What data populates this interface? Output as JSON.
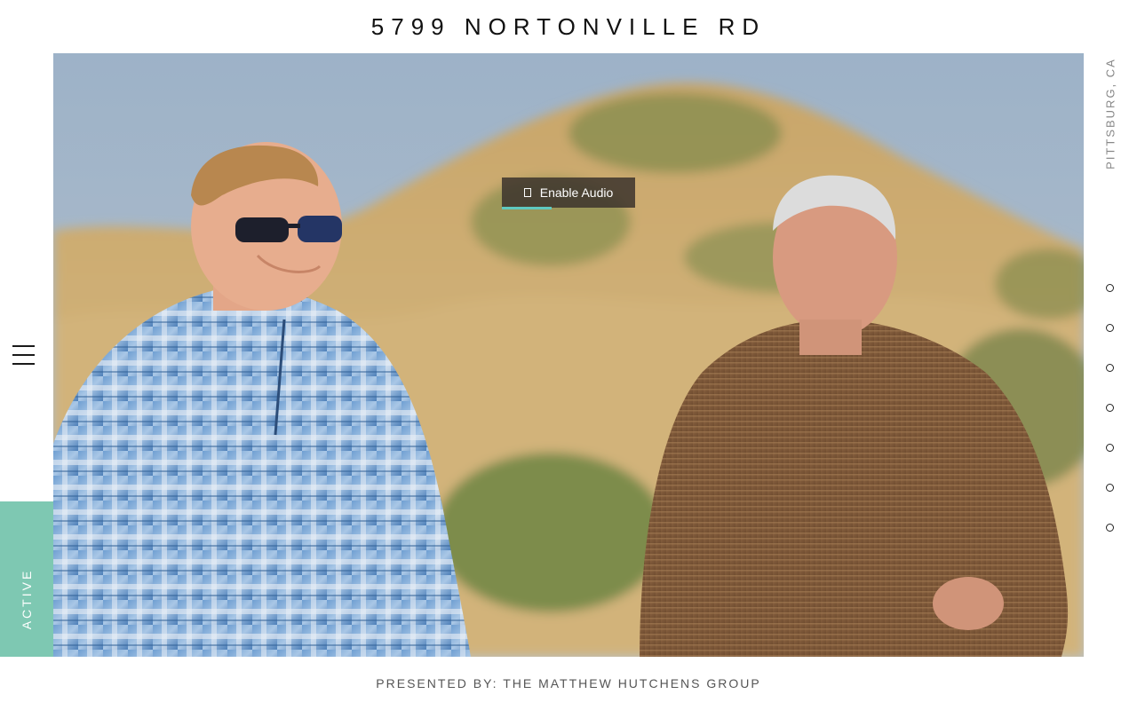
{
  "header": {
    "title": "5799 NORTONVILLE RD"
  },
  "sidebar_left": {
    "menu_icon": "hamburger-menu-icon",
    "status_label": "ACTIVE",
    "status_color": "#7ec8b2"
  },
  "hero": {
    "audio_button": {
      "icon": "speaker-icon",
      "label": "Enable Audio",
      "progress": 0.37,
      "progress_color": "#5fc9c0"
    }
  },
  "sidebar_right": {
    "location": "PITTSBURG, CA",
    "slide_dots": [
      {
        "name": "slide-dot-1"
      },
      {
        "name": "slide-dot-2"
      },
      {
        "name": "slide-dot-3"
      },
      {
        "name": "slide-dot-4"
      },
      {
        "name": "slide-dot-5"
      },
      {
        "name": "slide-dot-6"
      },
      {
        "name": "slide-dot-7"
      }
    ]
  },
  "footer": {
    "presented_by": "PRESENTED BY: THE MATTHEW HUTCHENS GROUP"
  }
}
